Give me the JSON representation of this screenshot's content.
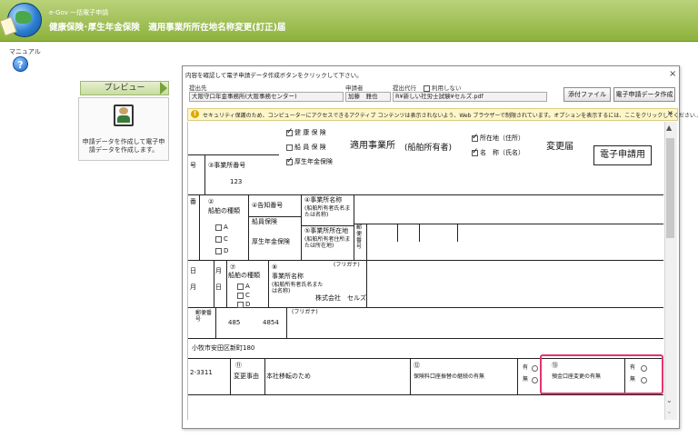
{
  "header": {
    "app_title": "e-Gov 一括電子申請",
    "subtitle": "健康保険･厚生年金保険　適用事業所所在地名称変更(訂正)届"
  },
  "manual": {
    "label": "マニュアル",
    "icon": "help-icon"
  },
  "preview": {
    "tab_label": "プレビュー",
    "description": "申請データを作成して電子申請データを作成します。"
  },
  "dialog": {
    "title": "内容を確認して電子申請データ作成ボタンをクリックして下さい。",
    "close": "×",
    "fields": {
      "submit_to_label": "提出先",
      "submit_to_value": "大阪守口年金事務所(大阪事務センター)",
      "applicant_label": "申請者",
      "applicant_value": "加藤　雅也",
      "proxy_label": "提出代行",
      "proxy_checkbox_label": "利用しない",
      "file_value": "R¥新しい社労士試験¥セルズ.pdf"
    },
    "buttons": {
      "attach": "添付ファイル",
      "create": "電子申請データ作成"
    },
    "infobar": {
      "text": "セキュリティ保護のため、コンピューターにアクセスできるアクティブ コンテンツは表示されないよう、Web ブラウザーで制限されています。オプションを表示するには、ここをクリックしてください...",
      "close": "×"
    }
  },
  "form": {
    "insurance": [
      "健 康 保 険",
      "船 員 保 険",
      "厚生年金保険"
    ],
    "insurance_checked": [
      true,
      false,
      true
    ],
    "title_main": "適用事業所",
    "title_ship": "(船舶所有者)",
    "loc_items": [
      "所在地（住所）",
      "名　称（氏名）"
    ],
    "change_label": "変更届",
    "electronic_label": "電子申請用",
    "office_no_label": "③事業所番号",
    "office_no_value": "123",
    "row2_left": "号",
    "row2_left2": "番",
    "ship_type_num": "②",
    "ship_type_label": "船舶の種類",
    "ship_types": [
      "A",
      "C",
      "D"
    ],
    "notice_no_label": "④告知番号",
    "seamen_label": "船員保険",
    "pension_label": "厚生年金保険",
    "office_name_label": "④事業所名称",
    "office_name_sub": "(船舶所有者氏名または名称)",
    "postal_label": "郵便番号",
    "office_addr_label": "⑤事業所所在地",
    "office_addr_sub": "(船舶所有者住所または所在地)",
    "ship_type2_num": "⑦",
    "ship_type2_label": "船舶の種類",
    "ship_types2": [
      "A",
      "C",
      "D"
    ],
    "date_label": "日",
    "month_label": "月",
    "office_name2_num": "⑧",
    "office_name2_label": "事業所名称",
    "office_name2_sub": "(船舶所有者氏名または名称)",
    "furigana": "(フリガナ)",
    "company_name": "株式会社　セルズ",
    "postal2_label": "郵便番号",
    "postal_a": "485",
    "postal_b": "4854",
    "furigana2": "(フリガナ)",
    "address": "小牧市安田区新町180",
    "phone_fragment": "2-3311",
    "reason_num": "⑪",
    "reason_label": "変更事由",
    "reason_value": "本社移転のため",
    "premium_num": "⑫",
    "premium_label": "保険料口座振替の継続の有無",
    "yes": "有",
    "no": "無",
    "pension_acct_num": "⑬",
    "pension_acct_label": "預金口座変更の有無"
  }
}
